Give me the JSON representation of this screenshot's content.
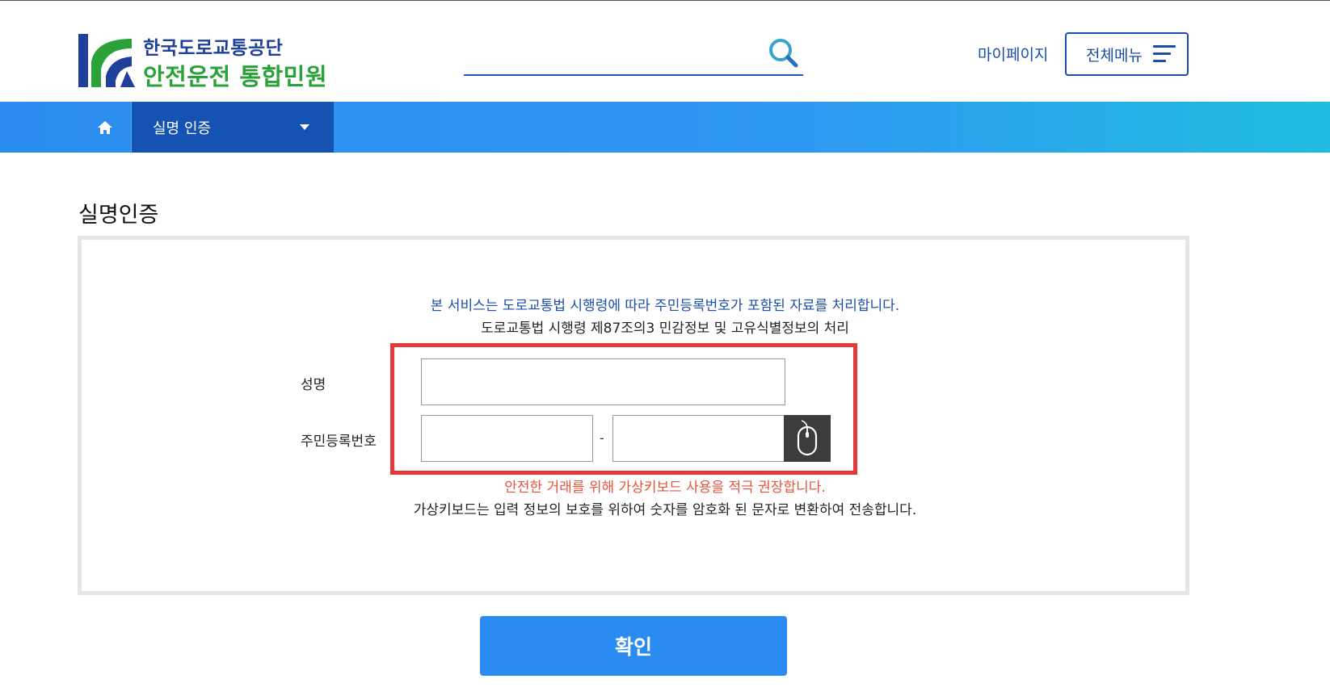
{
  "header": {
    "logo": {
      "line1": "한국도로교통공단",
      "line2": "안전운전 통합민원"
    },
    "search": {
      "placeholder": "",
      "icon": "search-icon"
    },
    "mypage_label": "마이페이지",
    "allmenu_label": "전체메뉴"
  },
  "nav": {
    "home_icon": "home-icon",
    "current_section": "실명 인증"
  },
  "page": {
    "title": "실명인증",
    "notice_line1": "본 서비스는 도로교통법 시행령에 따라 주민등록번호가 포함된 자료를 처리합니다.",
    "notice_line2": "도로교통법 시행령 제87조의3 민감정보 및 고유식별정보의 처리",
    "form": {
      "name_label": "성명",
      "name_value": "",
      "rrn_label": "주민등록번호",
      "rrn_front_value": "",
      "rrn_separator": "-",
      "rrn_back_value": "",
      "virtual_keyboard_icon": "mouse-icon"
    },
    "warning_text": "안전한 거래를 위해 가상키보드 사용을 적극 권장합니다.",
    "info_text": "가상키보드는 입력 정보의 보호를 위하여 숫자를 암호화 된 문자로 변환하여 전송합니다.",
    "confirm_label": "확인"
  },
  "colors": {
    "brand_blue": "#1b4ea8",
    "brand_green": "#2aa23a",
    "nav_blue": "#2a8cf0",
    "nav_dark": "#1553b3",
    "highlight_red": "#e5383b",
    "warning_text": "#e5553b"
  }
}
